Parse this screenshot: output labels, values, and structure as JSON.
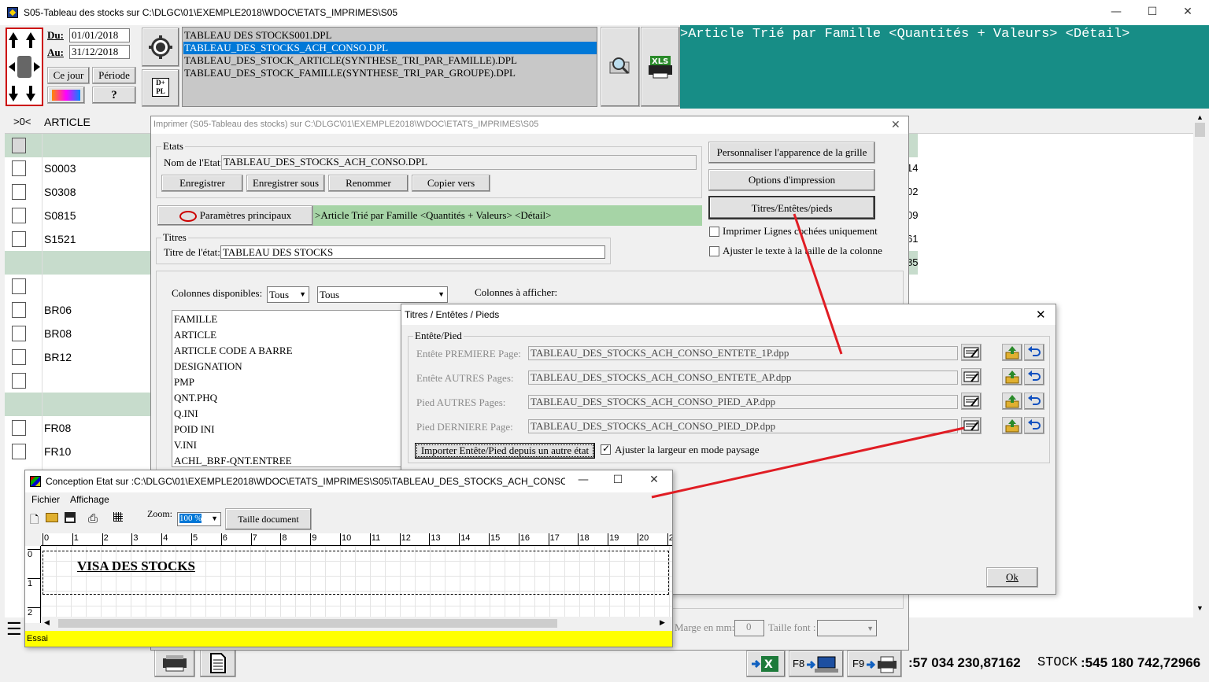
{
  "main": {
    "title": "S05-Tableau des stocks sur C:\\DLGC\\01\\EXEMPLE2018\\WDOC\\ETATS_IMPRIMES\\S05",
    "du_label": "Du:",
    "du_value": "01/01/2018",
    "au_label": "Au:",
    "au_value": "31/12/2018",
    "ce_jour": "Ce jour",
    "periode": "Période",
    "help": "?",
    "files": [
      "TABLEAU DES STOCKS001.DPL",
      "TABLEAU_DES_STOCKS_ACH_CONSO.DPL",
      "TABLEAU_DES_STOCK_ARTICLE(SYNTHESE_TRI_PAR_FAMILLE).DPL",
      "TABLEAU_DES_STOCK_FAMILLE(SYNTHESE_TRI_PAR_GROUPE).DPL"
    ],
    "header_text": ">Article Trié par Famille <Quantités + Valeurs>  <Détail>",
    "grid_col0": ">0<",
    "grid_col1": "ARTICLE",
    "rows": [
      "",
      "S0003",
      "S0308",
      "S0815",
      "S1521",
      "",
      "",
      "BR06",
      "BR08",
      "BR12",
      "",
      "",
      "FR08",
      "FR10"
    ],
    "right_values": [
      "14",
      "02",
      "09",
      "61",
      "85"
    ],
    "status_prefix": ":57 034 230,87162",
    "status_label": "STOCK",
    "status_value": ":545 180 742,72966",
    "f8": "F8",
    "f9": "F9"
  },
  "print_dialog": {
    "title": "Imprimer (S05-Tableau des stocks)  sur C:\\DLGC\\01\\EXEMPLE2018\\WDOC\\ETATS_IMPRIMES\\S05",
    "etats_label": "Etats",
    "nom_label": "Nom de l'Etat:",
    "nom_value": "TABLEAU_DES_STOCKS_ACH_CONSO.DPL",
    "btn_enregistrer": "Enregistrer",
    "btn_enregistrer_sous": "Enregistrer sous",
    "btn_renommer": "Renommer",
    "btn_copier": "Copier vers",
    "btn_personnaliser": "Personnaliser l'apparence de la grille",
    "btn_options": "Options d'impression",
    "btn_titres": "Titres/Entêtes/pieds",
    "chk_lignes": "Imprimer Lignes cochées uniquement",
    "chk_ajuster": "Ajuster le texte à la taille de la colonne",
    "btn_parametres": "Paramètres principaux",
    "param_text": ">Article Trié par Famille <Quantités + Valeurs>  <Détail>",
    "titres_label": "Titres",
    "titre_etat_label": "Titre de l'état:",
    "titre_etat_value": "TABLEAU DES STOCKS",
    "col_dispo_label": "Colonnes disponibles:",
    "col_dispo_select1": "Tous",
    "col_dispo_select2": "Tous",
    "col_afficher_label": "Colonnes à afficher:",
    "columns": [
      "FAMILLE",
      "ARTICLE",
      "ARTICLE CODE A BARRE",
      "DESIGNATION",
      "PMP",
      "QNT.PHQ",
      "Q.INI",
      "POID INI",
      "V.INI",
      "ACHL_BRF-QNT.ENTREE"
    ],
    "marge_label": "Marge en mm:",
    "marge_value": "0",
    "taille_font_label": "Taille font :"
  },
  "titres_dialog": {
    "title": "Titres / Entêtes / Pieds",
    "group_label": "Entête/Pied",
    "rows": [
      {
        "label": "Entête PREMIERE Page:",
        "value": "TABLEAU_DES_STOCKS_ACH_CONSO_ENTETE_1P.dpp"
      },
      {
        "label": "Entête AUTRES Pages:",
        "value": "TABLEAU_DES_STOCKS_ACH_CONSO_ENTETE_AP.dpp"
      },
      {
        "label": "Pied AUTRES Pages:",
        "value": "TABLEAU_DES_STOCKS_ACH_CONSO_PIED_AP.dpp"
      },
      {
        "label": "Pied DERNIERE Page:",
        "value": "TABLEAU_DES_STOCKS_ACH_CONSO_PIED_DP.dpp"
      }
    ],
    "btn_importer": "Importer Entête/Pied depuis un autre état",
    "chk_paysage": "Ajuster la largeur en mode paysage",
    "btn_ok": "Ok"
  },
  "conception": {
    "title": "Conception Etat sur :C:\\DLGC\\01\\EXEMPLE2018\\WDOC\\ETATS_IMPRIMES\\S05\\TABLEAU_DES_STOCKS_ACH_CONSO_PIED_...",
    "menu_fichier": "Fichier",
    "menu_affichage": "Affichage",
    "zoom_label": "Zoom:",
    "zoom_value": "100 %",
    "btn_taille": "Taille document",
    "ruler": [
      "0",
      "1",
      "2",
      "3",
      "4",
      "5",
      "6",
      "7",
      "8",
      "9",
      "10",
      "11",
      "12",
      "13",
      "14",
      "15",
      "16",
      "17",
      "18",
      "19",
      "20",
      "2"
    ],
    "vruler": [
      "0",
      "1",
      "2"
    ],
    "canvas_text": "VISA DES STOCKS",
    "status": "Essai"
  }
}
